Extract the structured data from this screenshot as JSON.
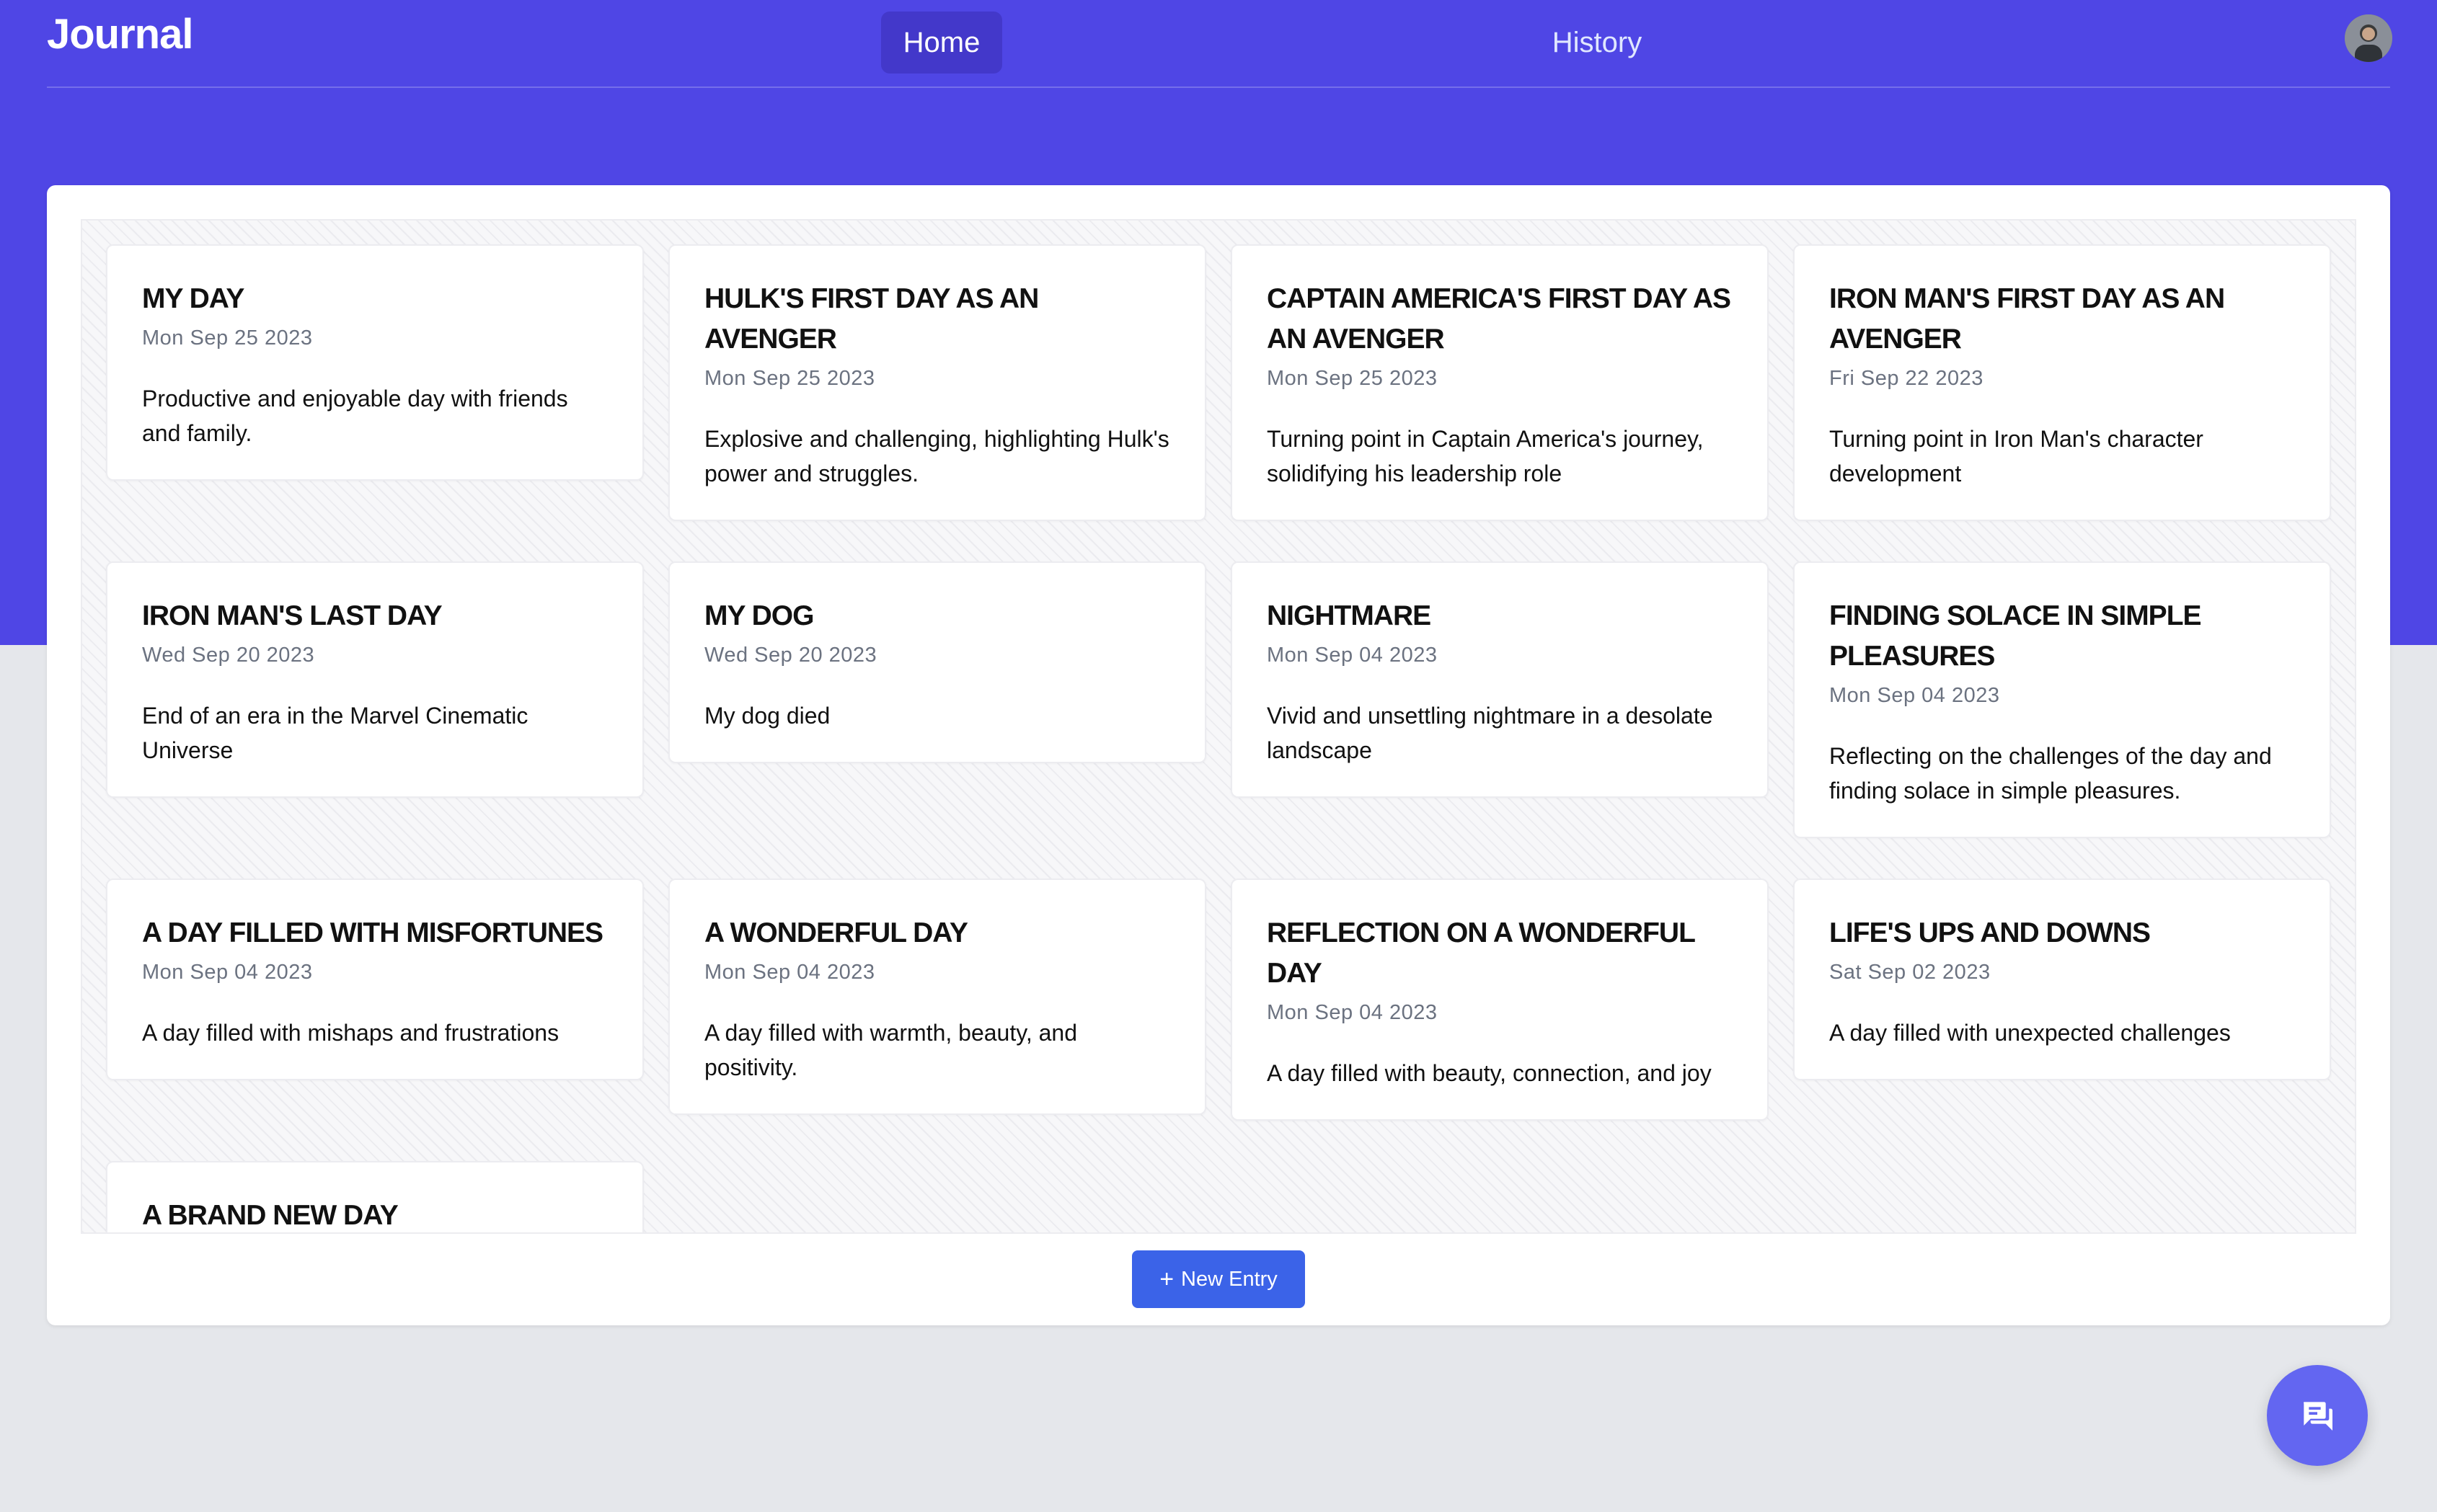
{
  "app": {
    "brand": "Journal"
  },
  "nav": {
    "home_label": "Home",
    "history_label": "History"
  },
  "colors": {
    "primary": "#4f46e5",
    "button": "#3b63e8",
    "fab": "#6366f1"
  },
  "entries": [
    {
      "title": "MY DAY",
      "date": "Mon Sep 25 2023",
      "description": "Productive and enjoyable day with friends and family."
    },
    {
      "title": "HULK'S FIRST DAY AS AN AVENGER",
      "date": "Mon Sep 25 2023",
      "description": "Explosive and challenging, highlighting Hulk's power and struggles."
    },
    {
      "title": "CAPTAIN AMERICA'S FIRST DAY AS AN AVENGER",
      "date": "Mon Sep 25 2023",
      "description": "Turning point in Captain America's journey, solidifying his leadership role"
    },
    {
      "title": "IRON MAN'S FIRST DAY AS AN AVENGER",
      "date": "Fri Sep 22 2023",
      "description": "Turning point in Iron Man's character development"
    },
    {
      "title": "IRON MAN'S LAST DAY",
      "date": "Wed Sep 20 2023",
      "description": "End of an era in the Marvel Cinematic Universe"
    },
    {
      "title": "MY DOG",
      "date": "Wed Sep 20 2023",
      "description": "My dog died"
    },
    {
      "title": "NIGHTMARE",
      "date": "Mon Sep 04 2023",
      "description": "Vivid and unsettling nightmare in a desolate landscape"
    },
    {
      "title": "FINDING SOLACE IN SIMPLE PLEASURES",
      "date": "Mon Sep 04 2023",
      "description": "Reflecting on the challenges of the day and finding solace in simple pleasures."
    },
    {
      "title": "A DAY FILLED WITH MISFORTUNES",
      "date": "Mon Sep 04 2023",
      "description": "A day filled with mishaps and frustrations"
    },
    {
      "title": "A WONDERFUL DAY",
      "date": "Mon Sep 04 2023",
      "description": "A day filled with warmth, beauty, and positivity."
    },
    {
      "title": "REFLECTION ON A WONDERFUL DAY",
      "date": "Mon Sep 04 2023",
      "description": "A day filled with beauty, connection, and joy"
    },
    {
      "title": "LIFE'S UPS AND DOWNS",
      "date": "Sat Sep 02 2023",
      "description": "A day filled with unexpected challenges"
    },
    {
      "title": "A BRAND NEW DAY",
      "date": "",
      "description": ""
    }
  ],
  "actions": {
    "new_entry_label": "New Entry"
  },
  "icons": {
    "plus": "plus-icon",
    "chat": "chat-icon",
    "avatar": "avatar"
  }
}
